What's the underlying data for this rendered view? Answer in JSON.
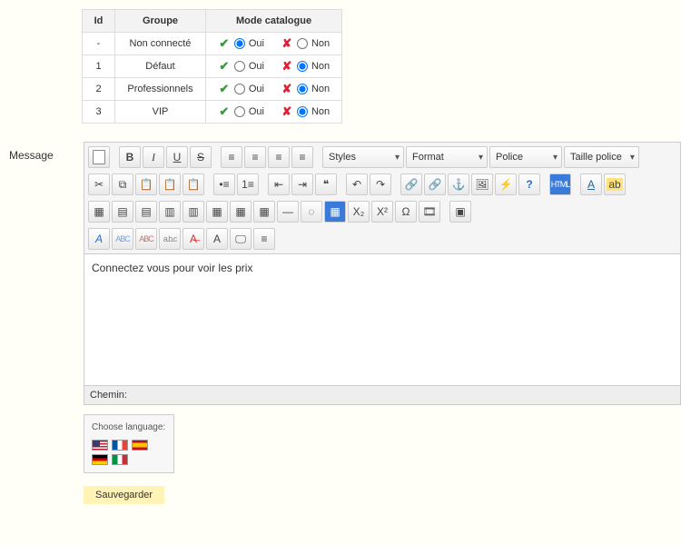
{
  "table": {
    "headers": {
      "id": "Id",
      "group": "Groupe",
      "mode": "Mode catalogue"
    },
    "yes": "Oui",
    "no": "Non",
    "rows": [
      {
        "id": "-",
        "group": "Non connecté",
        "selected": "oui"
      },
      {
        "id": "1",
        "group": "Défaut",
        "selected": "non"
      },
      {
        "id": "2",
        "group": "Professionnels",
        "selected": "non"
      },
      {
        "id": "3",
        "group": "VIP",
        "selected": "non"
      }
    ]
  },
  "labels": {
    "message": "Message",
    "path": "Chemin:",
    "choose_lang": "Choose language:",
    "save": "Sauvegarder"
  },
  "editor": {
    "content": "Connectez vous pour voir les prix",
    "dropdowns": {
      "styles": "Styles",
      "format": "Format",
      "font": "Police",
      "size": "Taille police"
    }
  }
}
